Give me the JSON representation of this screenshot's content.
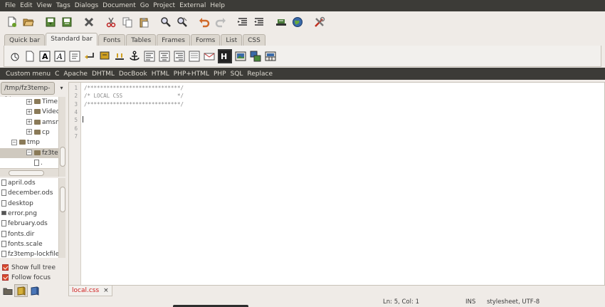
{
  "menubar": [
    "File",
    "Edit",
    "View",
    "Tags",
    "Dialogs",
    "Document",
    "Go",
    "Project",
    "External",
    "Help"
  ],
  "toolbar_icons": [
    "new-file-icon",
    "open-file-icon",
    "save-icon",
    "save-all-icon",
    "close-icon",
    "cut-icon",
    "copy-icon",
    "paste-icon",
    "find-icon",
    "find-replace-icon",
    "undo-icon",
    "redo-icon",
    "indent-icon",
    "unindent-icon",
    "preview-icon",
    "browser-icon",
    "preferences-icon"
  ],
  "tabs": [
    "Quick bar",
    "Standard bar",
    "Fonts",
    "Tables",
    "Frames",
    "Forms",
    "List",
    "CSS"
  ],
  "active_tab": "Standard bar",
  "standard_bar_icons": [
    "quickstart-icon",
    "body-icon",
    "bold-icon",
    "italic-icon",
    "paragraph-icon",
    "break-icon",
    "break-clear-icon",
    "nbsp-icon",
    "anchor-icon",
    "align-left-icon",
    "align-center-icon",
    "align-right-icon",
    "comment-icon",
    "email-icon",
    "heading-icon",
    "image-icon",
    "thumbnail-icon",
    "table-icon"
  ],
  "custom_menu": [
    "Custom menu",
    "C",
    "Apache",
    "DHTML",
    "DocBook",
    "HTML",
    "PHP+HTML",
    "PHP",
    "SQL",
    "Replace"
  ],
  "sidebar": {
    "path": "/tmp/fz3temp-1/",
    "tree": [
      {
        "label": "Time",
        "expander": "+",
        "indent": 2
      },
      {
        "label": "Video",
        "expander": "+",
        "indent": 2
      },
      {
        "label": "amsn",
        "expander": "+",
        "indent": 2
      },
      {
        "label": "cp",
        "expander": "+",
        "indent": 2
      },
      {
        "label": "tmp",
        "expander": "−",
        "indent": 1
      },
      {
        "label": "fz3temp",
        "expander": "−",
        "indent": 2,
        "selected": true
      },
      {
        "label": ".",
        "expander": "",
        "indent": 3,
        "file": true
      }
    ],
    "files": [
      "april.ods",
      "december.ods",
      "desktop",
      "error.png",
      "february.ods",
      "fonts.dir",
      "fonts.scale",
      "fz3temp-lockfile"
    ],
    "show_full_tree": "Show full tree",
    "follow_focus": "Follow focus"
  },
  "editor": {
    "lines": [
      "/*****************************/",
      "/* LOCAL CSS                 */",
      "/*****************************/",
      "",
      "",
      "",
      ""
    ],
    "line_numbers": [
      "1",
      "2",
      "3",
      "4",
      "5",
      "6",
      "7"
    ]
  },
  "document_tab": {
    "label": "local.css",
    "close": "×"
  },
  "status": {
    "position": "Ln: 5, Col: 1",
    "mode": "INS",
    "filetype": "stylesheet, UTF-8"
  },
  "colors": {
    "menubar": "#3c3b37",
    "accent": "#d94a2b",
    "tab_text": "#d02020"
  }
}
